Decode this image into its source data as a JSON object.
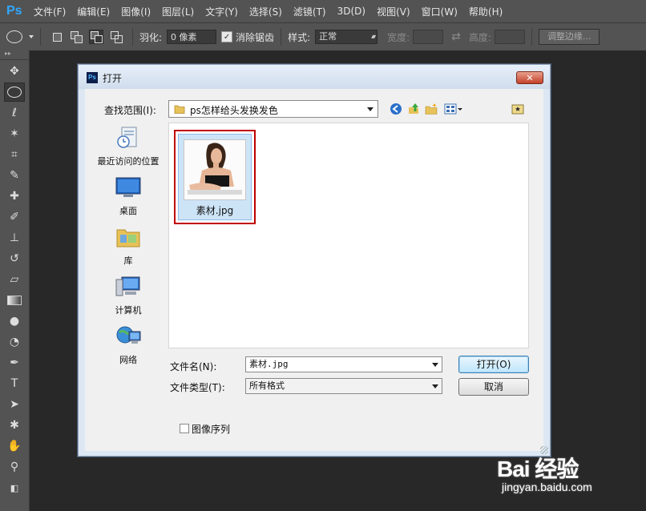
{
  "app": {
    "logo": "Ps",
    "menu": [
      "文件(F)",
      "编辑(E)",
      "图像(I)",
      "图层(L)",
      "文字(Y)",
      "选择(S)",
      "滤镜(T)",
      "3D(D)",
      "视图(V)",
      "窗口(W)",
      "帮助(H)"
    ]
  },
  "options": {
    "feather_label": "羽化:",
    "feather_value": "0 像素",
    "antialias_label": "消除锯齿",
    "style_label": "样式:",
    "style_value": "正常",
    "width_label": "宽度:",
    "height_label": "高度:",
    "refine_edge": "调整边缘..."
  },
  "dialog": {
    "title": "打开",
    "close": "✕",
    "look_in_label": "查找范围(I):",
    "look_in_value": "ps怎样给头发换发色",
    "places": [
      {
        "label": "最近访问的位置"
      },
      {
        "label": "桌面"
      },
      {
        "label": "库"
      },
      {
        "label": "计算机"
      },
      {
        "label": "网络"
      }
    ],
    "files": [
      {
        "name": "素材.jpg"
      }
    ],
    "filename_label": "文件名(N):",
    "filename_value": "素材.jpg",
    "filetype_label": "文件类型(T):",
    "filetype_value": "所有格式",
    "open_button": "打开(O)",
    "cancel_button": "取消",
    "image_sequence_label": "图像序列"
  },
  "watermark": {
    "brand": "Bai 经验",
    "url": "jingyan.baidu.com"
  }
}
